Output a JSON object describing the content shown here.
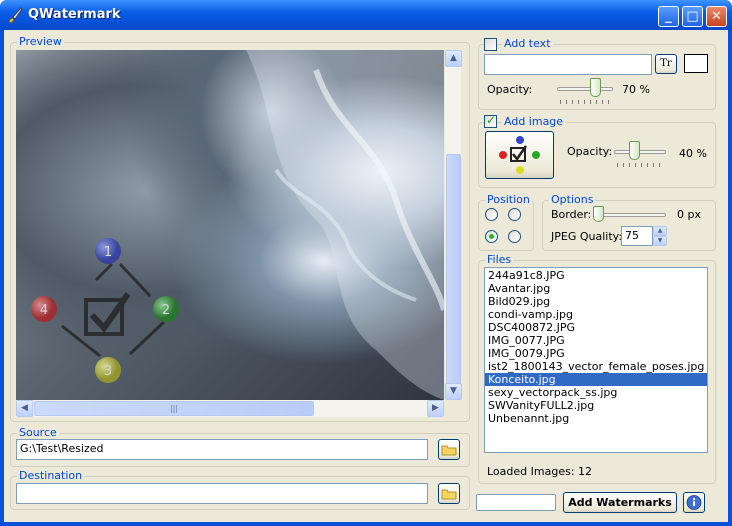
{
  "window": {
    "title": "QWatermark",
    "minimize": "_",
    "maximize": "□",
    "close": "✕"
  },
  "preview": {
    "label": "Preview",
    "icon": "watermark-compass-icon"
  },
  "source": {
    "label": "Source",
    "value": "G:\\Test\\Resized"
  },
  "destination": {
    "label": "Destination",
    "value": ""
  },
  "add_text": {
    "label": "Add text",
    "checked": false,
    "value": "",
    "font_button": "Tr",
    "opacity_label": "Opacity:",
    "opacity_value": "70 %",
    "opacity": 0.7
  },
  "add_image": {
    "label": "Add image",
    "checked": true,
    "opacity_label": "Opacity:",
    "opacity_value": "40 %",
    "opacity": 0.4
  },
  "position": {
    "label": "Position"
  },
  "options": {
    "label": "Options",
    "border_label": "Border:",
    "border_value": "0 px",
    "jpeg_label": "JPEG Quality:",
    "jpeg_value": "75"
  },
  "files": {
    "label": "Files",
    "items": [
      "244a91c8.JPG",
      "Avantar.jpg",
      "Bild029.jpg",
      "condi-vamp.jpg",
      "DSC400872.JPG",
      "IMG_0077.JPG",
      "IMG_0079.JPG",
      "ist2_1800143_vector_female_poses.jpg",
      "Konceito.jpg",
      "sexy_vectorpack_ss.jpg",
      "SWVanityFULL2.jpg",
      "Unbenannt.jpg"
    ],
    "selected": "Konceito.jpg",
    "loaded": "Loaded Images: 12"
  },
  "footer": {
    "add_button": "Add Watermarks",
    "info_icon": "info-icon"
  },
  "colors": {
    "accent": "#0046d5",
    "selection": "#316ac5",
    "titlebar": "#0a5de6"
  }
}
